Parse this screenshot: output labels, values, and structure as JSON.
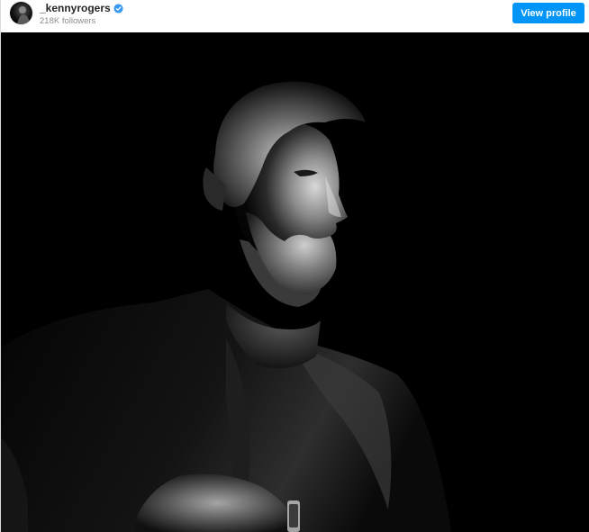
{
  "profile": {
    "username": "_kennyrogers",
    "followers": "218K followers",
    "verified": true,
    "avatar_icon": "profile-avatar",
    "view_profile_label": "View profile"
  },
  "colors": {
    "accent": "#0095f6",
    "photo_background": "#000000"
  },
  "post": {
    "image_icon": "bw-portrait-photo"
  }
}
